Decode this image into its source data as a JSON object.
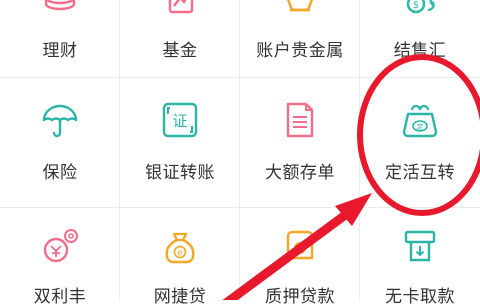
{
  "colors": {
    "pink": "#f26d8a",
    "orange": "#f5a623",
    "teal": "#2bb5a6",
    "red_annotation": "#e8192c"
  },
  "grid": {
    "row1": [
      {
        "label": "理财",
        "icon": "coins-icon"
      },
      {
        "label": "基金",
        "icon": "fund-icon"
      },
      {
        "label": "账户贵金属",
        "icon": "gold-icon"
      },
      {
        "label": "结售汇",
        "icon": "exchange-icon"
      }
    ],
    "row2": [
      {
        "label": "保险",
        "icon": "umbrella-icon"
      },
      {
        "label": "银证转账",
        "icon": "securities-transfer-icon"
      },
      {
        "label": "大额存单",
        "icon": "certificate-document-icon"
      },
      {
        "label": "定活互转",
        "icon": "fixed-deposit-purse-icon",
        "icon_text": "定"
      }
    ],
    "row3": [
      {
        "label": "双利丰",
        "icon": "coin-stack-icon"
      },
      {
        "label": "网捷贷",
        "icon": "money-bag-icon",
        "icon_text": "e"
      },
      {
        "label": "质押贷款",
        "icon": "pledge-loan-icon"
      },
      {
        "label": "无卡取款",
        "icon": "atm-cardless-icon"
      }
    ]
  }
}
